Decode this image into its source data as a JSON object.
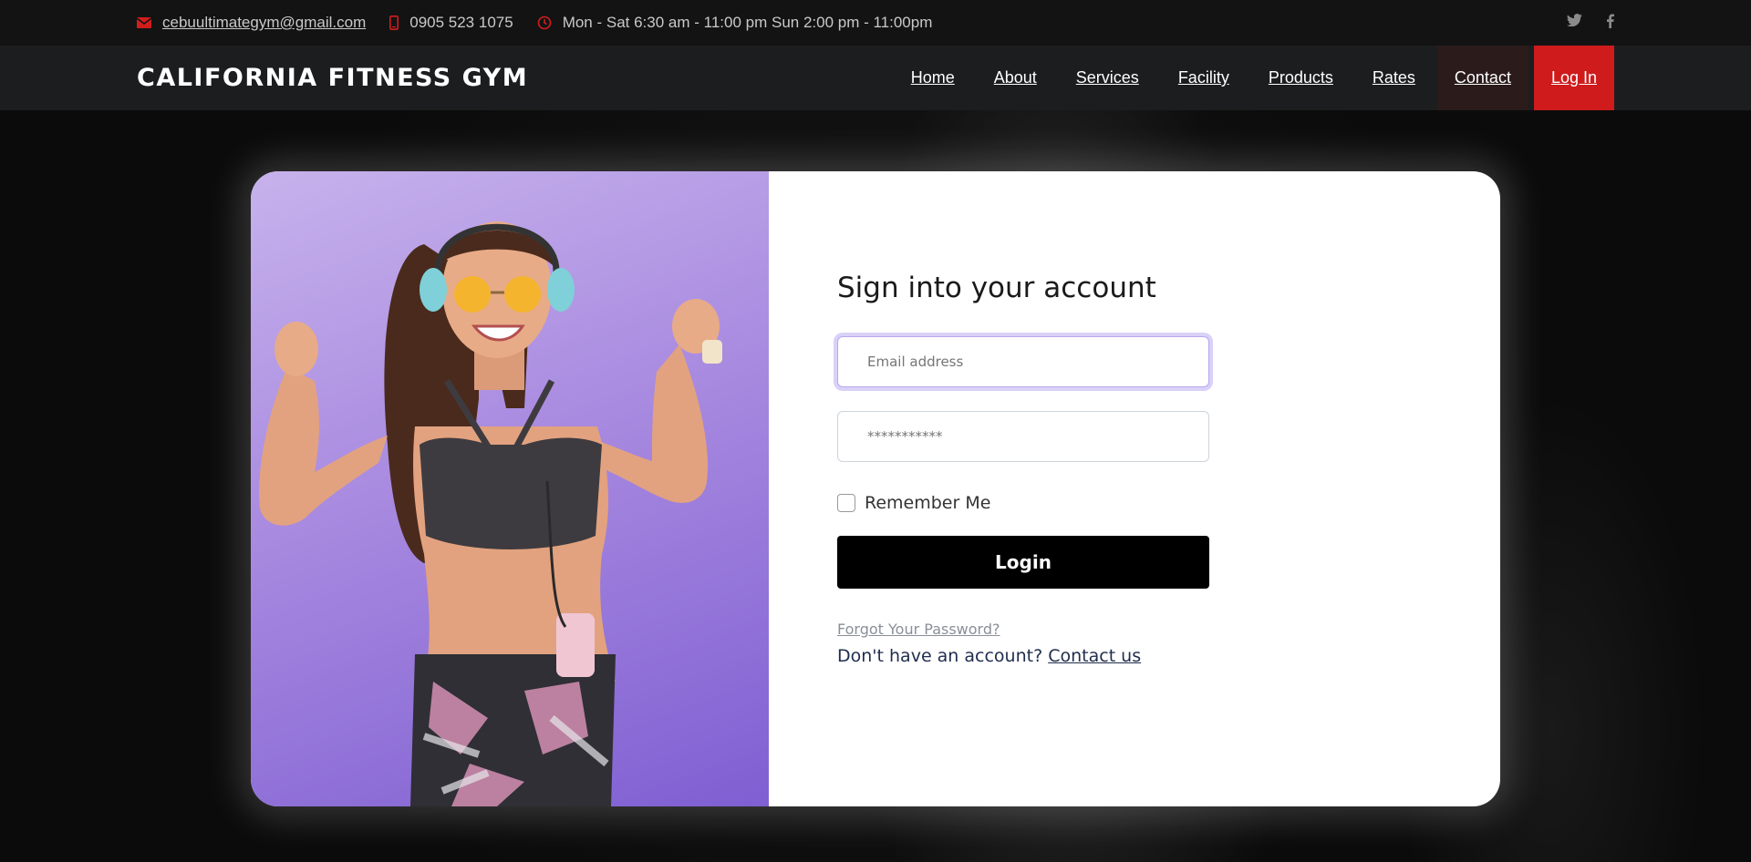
{
  "topbar": {
    "email": "cebuultimategym@gmail.com",
    "phone": "0905 523 1075",
    "hours": "Mon - Sat 6:30 am - 11:00 pm Sun 2:00 pm - 11:00pm",
    "social": [
      {
        "icon": "twitter-icon",
        "glyph": "🐦"
      },
      {
        "icon": "facebook-icon",
        "glyph": "f"
      }
    ]
  },
  "navbar": {
    "brand": "CALIFORNIA FITNESS GYM",
    "links": [
      "Home",
      "About",
      "Services",
      "Facility",
      "Products",
      "Rates",
      "Contact",
      "Log In"
    ]
  },
  "login": {
    "title": "Sign into your account",
    "email_placeholder": "Email address",
    "password_placeholder": "***********",
    "remember_label": "Remember Me",
    "button_label": "Login",
    "forgot_label": "Forgot Your Password?",
    "signup_prompt": "Don't have an account?",
    "signup_link": "Contact us"
  },
  "colors": {
    "accent": "#cf1b1b",
    "button": "#000000",
    "photo_bg": "#a88ae0"
  }
}
